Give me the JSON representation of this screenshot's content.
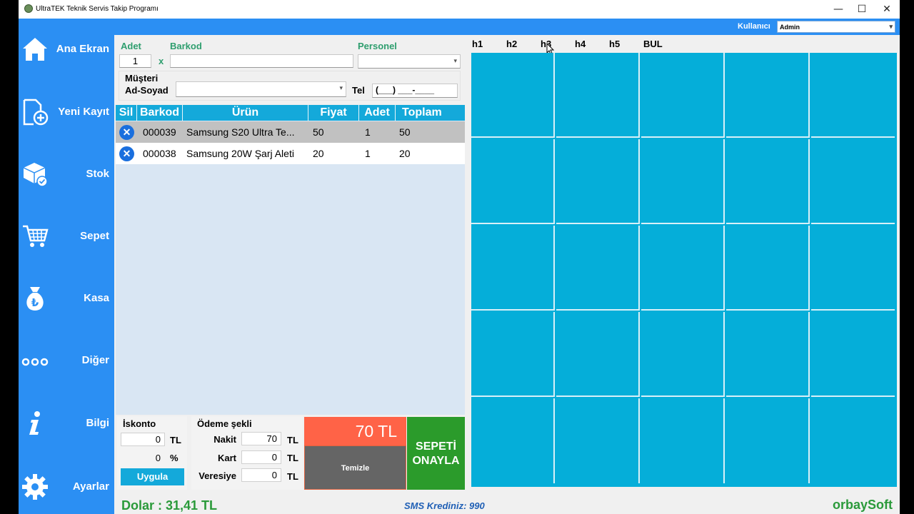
{
  "window": {
    "title": "UltraTEK Teknik Servis Takip Programı",
    "controls": {
      "minimize": "—",
      "maximize": "☐",
      "close": "✕"
    }
  },
  "sidebar": {
    "items": [
      {
        "label": "Ana Ekran",
        "icon": "home-icon"
      },
      {
        "label": "Yeni Kayıt",
        "icon": "new-document-icon"
      },
      {
        "label": "Stok",
        "icon": "stock-box-icon"
      },
      {
        "label": "Sepet",
        "icon": "cart-icon"
      },
      {
        "label": "Kasa",
        "icon": "money-bag-icon"
      },
      {
        "label": "Diğer",
        "icon": "more-dots-icon"
      },
      {
        "label": "Bilgi",
        "icon": "info-icon"
      },
      {
        "label": "Ayarlar",
        "icon": "gear-icon"
      }
    ]
  },
  "topbar": {
    "user_label": "Kullanıcı",
    "user_value": "Admin"
  },
  "form": {
    "adet_label": "Adet",
    "adet_value": "1",
    "x_label": "x",
    "barkod_label": "Barkod",
    "barkod_value": "",
    "personel_label": "Personel",
    "personel_value": "",
    "musteri_label": "Müşteri",
    "adsoyad_label": "Ad-Soyad",
    "adsoyad_value": "",
    "tel_label": "Tel",
    "tel_value": "(___) ___-____"
  },
  "table": {
    "columns": [
      "Sil",
      "Barkod",
      "Ürün",
      "Fiyat",
      "Adet",
      "Toplam"
    ],
    "rows": [
      {
        "barkod": "000039",
        "urun": "Samsung S20 Ultra Te...",
        "fiyat": "50",
        "adet": "1",
        "toplam": "50"
      },
      {
        "barkod": "000038",
        "urun": "Samsung 20W Şarj Aleti",
        "fiyat": "20",
        "adet": "1",
        "toplam": "20"
      }
    ]
  },
  "iskonto": {
    "label": "İskonto",
    "tl_value": "0",
    "tl_unit": "TL",
    "pct_value": "0",
    "pct_unit": "%",
    "apply_label": "Uygula"
  },
  "odeme": {
    "label": "Ödeme şekli",
    "nakit_label": "Nakit",
    "nakit_value": "70",
    "kart_label": "Kart",
    "kart_value": "0",
    "veresiye_label": "Veresiye",
    "veresiye_value": "0",
    "unit": "TL"
  },
  "total": {
    "amount": "70 TL",
    "clear_label": "Temizle"
  },
  "confirm_label": "SEPETİ ONAYLA",
  "tile_tabs": [
    "h1",
    "h2",
    "h3",
    "h4",
    "h5",
    "BUL"
  ],
  "status": {
    "dolar": "Dolar : 31,41 TL",
    "sms": "SMS Krediniz: 990",
    "brand": "orbaySoft"
  },
  "colors": {
    "sidebar": "#2b8ff3",
    "tiles": "#05aed9",
    "grid_header": "#14a9da",
    "total_bg": "#ff6347",
    "confirm_bg": "#2b9b2b",
    "clear_bg": "#656565",
    "label_green": "#2e9e6e"
  }
}
